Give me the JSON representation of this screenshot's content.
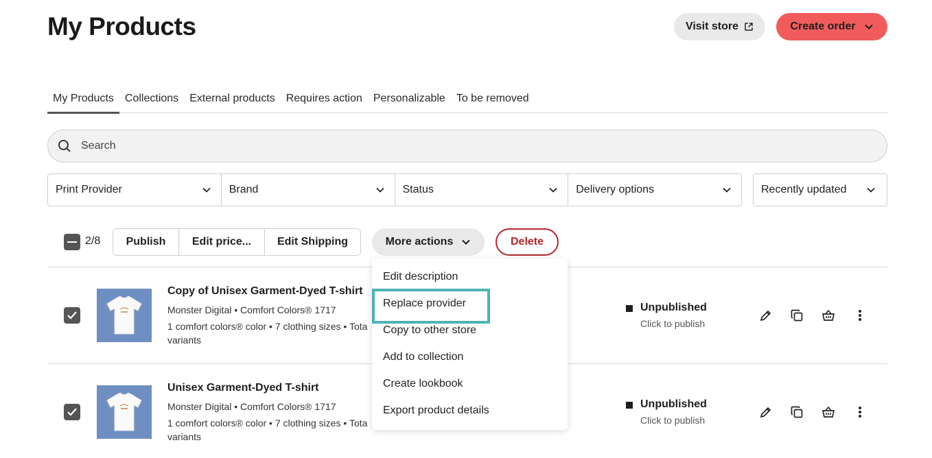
{
  "page": {
    "title": "My Products"
  },
  "header": {
    "visit_store": "Visit store",
    "create_order": "Create order"
  },
  "tabs": [
    {
      "label": "My Products",
      "active": true
    },
    {
      "label": "Collections"
    },
    {
      "label": "External products"
    },
    {
      "label": "Requires action"
    },
    {
      "label": "Personalizable"
    },
    {
      "label": "To be removed"
    }
  ],
  "search": {
    "placeholder": "Search"
  },
  "filters": {
    "print_provider": "Print Provider",
    "brand": "Brand",
    "status": "Status",
    "delivery": "Delivery options",
    "sort": "Recently updated"
  },
  "bulk": {
    "count": "2/8",
    "publish": "Publish",
    "edit_price": "Edit price...",
    "edit_shipping": "Edit Shipping",
    "more_actions": "More actions",
    "delete": "Delete"
  },
  "more_menu": [
    "Edit description",
    "Replace provider",
    "Copy to other store",
    "Add to collection",
    "Create lookbook",
    "Export product details"
  ],
  "products": [
    {
      "title": "Copy of Unisex Garment-Dyed T-shirt",
      "provider": "Monster Digital • Comfort Colors® 1717",
      "variants": "1 comfort colors® color • 7 clothing sizes • Tota",
      "variants_cont": "variants",
      "status": "Unpublished",
      "status_hint": "Click to publish"
    },
    {
      "title": "Unisex Garment-Dyed T-shirt",
      "provider": "Monster Digital • Comfort Colors® 1717",
      "variants": "1 comfort colors® color • 7 clothing sizes • Tota",
      "variants_cont": "variants",
      "status": "Unpublished",
      "status_hint": "Click to publish"
    }
  ],
  "colors": {
    "accent": "#f15b5b",
    "danger": "#b3262a",
    "focus_ring": "#4eb3b3",
    "thumb_bg": "#6f8fc2"
  },
  "icons": {
    "visit_store": "external-link-icon",
    "create_order": "chevron-down-icon",
    "search": "search-icon",
    "edit": "pencil-icon",
    "duplicate": "copy-icon",
    "shop": "basket-icon",
    "more": "vertical-dots-icon"
  }
}
